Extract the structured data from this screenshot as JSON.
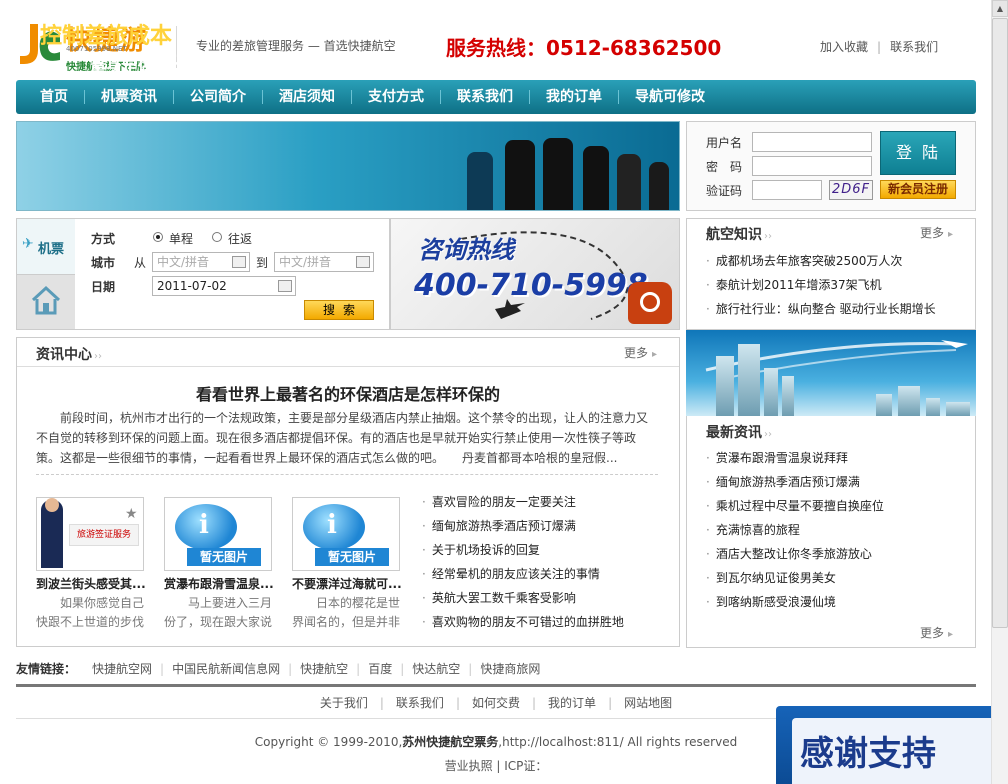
{
  "header": {
    "logo_brand": "快捷游",
    "logo_brand_sub": "4007105998.NET",
    "logo_sub": "快捷航空旗下品牌",
    "slogan": "专业的差旅管理服务 — 首选快捷航空",
    "hotline": "服务热线：0512-68362500",
    "bookmark": "加入收藏",
    "contact": "联系我们"
  },
  "nav": [
    "首页",
    "机票资讯",
    "公司简介",
    "酒店须知",
    "支付方式",
    "联系我们",
    "我的订单",
    "导航可修改"
  ],
  "banner": {
    "line1": "控制差旅成本",
    "line2_a": "量身定做",
    "line2_b": "差旅管理",
    "line2_c": "制度"
  },
  "login": {
    "username_label": "用户名",
    "password_label": "密　码",
    "captcha_label": "验证码",
    "captcha_code": "2D6F",
    "login_button": "登陆",
    "register_button": "新会员注册"
  },
  "ticket": {
    "tab": "机票",
    "mode_label": "方式",
    "one_way": "单程",
    "round_trip": "往返",
    "city_label": "城市",
    "from": "从",
    "to": "到",
    "city_placeholder": "中文/拼音",
    "date_label": "日期",
    "date_value": "2011-07-02",
    "search_button": "搜索"
  },
  "consult": {
    "line1": "咨询热线",
    "line2": "400-710-5998"
  },
  "aviation": {
    "title": "航空知识",
    "more": "更多",
    "items": [
      "成都机场去年旅客突破2500万人次",
      "泰航计划2011年增添37架飞机",
      "旅行社行业：纵向整合 驱动行业长期增长"
    ]
  },
  "news_center": {
    "title": "资讯中心",
    "more": "更多",
    "headline": "看看世界上最著名的环保酒店是怎样环保的",
    "body": "前段时间，杭州市才出行的一个法规政策，主要是部分星级酒店内禁止抽烟。这个禁令的出现，让人的注意力又不自觉的转移到环保的问题上面。现在很多酒店都提倡环保。有的酒店也是早就开始实行禁止使用一次性筷子等政策。这都是一些很细节的事情，一起看看世界上最环保的酒店式怎么做的吧。　　丹麦首都哥本哈根的皇冠假...",
    "thumbs": [
      {
        "title": "到波兰街头感受其...",
        "desc": "如果你感觉自己快跟不上世道的步伐"
      },
      {
        "title": "赏瀑布跟滑雪温泉...",
        "desc": "马上要进入三月份了，现在跟大家说说"
      },
      {
        "title": "不要漂洋过海就可...",
        "desc": "日本的樱花是世界闻名的，但是并非是只有"
      }
    ],
    "no_image": "暂无图片",
    "poster_text": "旅游签证服务",
    "list": [
      "喜欢冒险的朋友一定要关注",
      "缅甸旅游热季酒店预订爆满",
      "关于机场投诉的回复",
      "经常晕机的朋友应该关注的事情",
      "英航大罢工数千乘客受影响",
      "喜欢购物的朋友不可错过的血拼胜地"
    ]
  },
  "latest": {
    "title": "最新资讯",
    "more": "更多",
    "items": [
      "赏瀑布跟滑雪温泉说拜拜",
      "缅甸旅游热季酒店预订爆满",
      "乘机过程中尽量不要擅自换座位",
      "充满惊喜的旅程",
      "酒店大整改让你冬季旅游放心",
      "到瓦尔纳见证俊男美女",
      "到喀纳斯感受浪漫仙境"
    ]
  },
  "friend": {
    "label": "友情链接：",
    "links": [
      "快捷航空网",
      "中国民航新闻信息网",
      "快捷航空",
      "百度",
      "快达航空",
      "快捷商旅网"
    ]
  },
  "footer": {
    "links": [
      "关于我们",
      "联系我们",
      "如何交费",
      "我的订单",
      "网站地图"
    ],
    "copyright_a": "Copyright © 1999-2010,",
    "copyright_b": "苏州快捷航空票务",
    "copyright_c": ",http://localhost:811/ All rights reserved",
    "license": "营业执照 | ICP证："
  },
  "float": {
    "thanks": "感谢支持"
  },
  "colors": {
    "nav": "#0e7086",
    "hotline": "#d40000",
    "accent_orange": "#f3a900",
    "logo_orange": "#f08c00",
    "logo_green": "#2a8a3a"
  }
}
